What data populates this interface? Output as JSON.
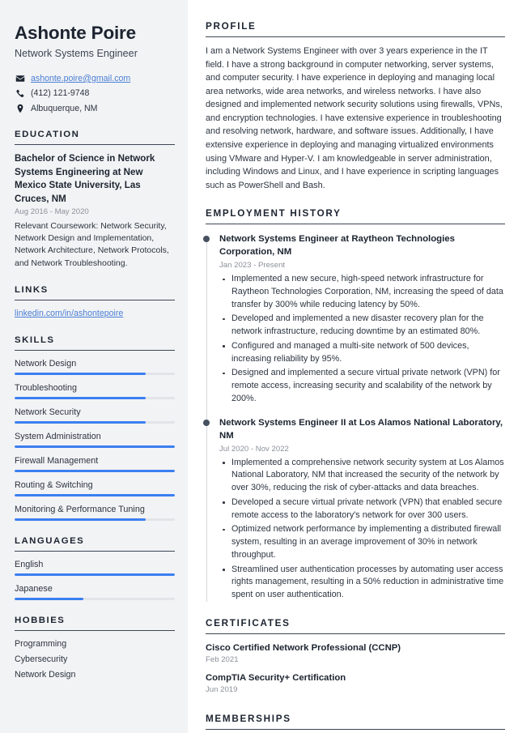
{
  "header": {
    "name": "Ashonte Poire",
    "role": "Network Systems Engineer",
    "contact": [
      {
        "icon": "envelope-icon",
        "text": "ashonte.poire@gmail.com",
        "is_link": true
      },
      {
        "icon": "phone-icon",
        "text": "(412) 121-9748",
        "is_link": false
      },
      {
        "icon": "location-pin-icon",
        "text": "Albuquerque, NM",
        "is_link": false
      }
    ]
  },
  "sidebar": {
    "education": {
      "heading": "EDUCATION",
      "degree": "Bachelor of Science in Network Systems Engineering at New Mexico State University, Las Cruces, NM",
      "date": "Aug 2016 - May 2020",
      "description": "Relevant Coursework: Network Security, Network Design and Implementation, Network Architecture, Network Protocols, and Network Troubleshooting."
    },
    "links": {
      "heading": "LINKS",
      "items": [
        {
          "label": "linkedin.com/in/ashontepoire"
        }
      ]
    },
    "skills": {
      "heading": "SKILLS",
      "items": [
        {
          "label": "Network Design",
          "level": 82
        },
        {
          "label": "Troubleshooting",
          "level": 82
        },
        {
          "label": "Network Security",
          "level": 82
        },
        {
          "label": "System Administration",
          "level": 100
        },
        {
          "label": "Firewall Management",
          "level": 100
        },
        {
          "label": "Routing & Switching",
          "level": 100
        },
        {
          "label": "Monitoring & Performance Tuning",
          "level": 82
        }
      ]
    },
    "languages": {
      "heading": "LANGUAGES",
      "items": [
        {
          "label": "English",
          "level": 100
        },
        {
          "label": "Japanese",
          "level": 43
        }
      ]
    },
    "hobbies": {
      "heading": "HOBBIES",
      "items": [
        {
          "label": "Programming"
        },
        {
          "label": "Cybersecurity"
        },
        {
          "label": "Network Design"
        }
      ]
    }
  },
  "main": {
    "profile": {
      "heading": "PROFILE",
      "text": "I am a Network Systems Engineer with over 3 years experience in the IT field. I have a strong background in computer networking, server systems, and computer security. I have experience in deploying and managing local area networks, wide area networks, and wireless networks. I have also designed and implemented network security solutions using firewalls, VPNs, and encryption technologies. I have extensive experience in troubleshooting and resolving network, hardware, and software issues. Additionally, I have extensive experience in deploying and managing virtualized environments using VMware and Hyper-V. I am knowledgeable in server administration, including Windows and Linux, and I have experience in scripting languages such as PowerShell and Bash."
    },
    "employment": {
      "heading": "EMPLOYMENT HISTORY",
      "jobs": [
        {
          "title": "Network Systems Engineer at Raytheon Technologies Corporation, NM",
          "date": "Jan 2023 - Present",
          "bullets": [
            "Implemented a new secure, high-speed network infrastructure for Raytheon Technologies Corporation, NM, increasing the speed of data transfer by 300% while reducing latency by 50%.",
            "Developed and implemented a new disaster recovery plan for the network infrastructure, reducing downtime by an estimated 80%.",
            "Configured and managed a multi-site network of 500 devices, increasing reliability by 95%.",
            "Designed and implemented a secure virtual private network (VPN) for remote access, increasing security and scalability of the network by 200%."
          ]
        },
        {
          "title": "Network Systems Engineer II at Los Alamos National Laboratory, NM",
          "date": "Jul 2020 - Nov 2022",
          "bullets": [
            "Implemented a comprehensive network security system at Los Alamos National Laboratory, NM that increased the security of the network by over 30%, reducing the risk of cyber-attacks and data breaches.",
            "Developed a secure virtual private network (VPN) that enabled secure remote access to the laboratory's network for over 300 users.",
            "Optimized network performance by implementing a distributed firewall system, resulting in an average improvement of 30% in network throughput.",
            "Streamlined user authentication processes by automating user access rights management, resulting in a 50% reduction in administrative time spent on user authentication."
          ]
        }
      ]
    },
    "certificates": {
      "heading": "CERTIFICATES",
      "items": [
        {
          "name": "Cisco Certified Network Professional (CCNP)",
          "date": "Feb 2021"
        },
        {
          "name": "CompTIA Security+ Certification",
          "date": "Jun 2019"
        }
      ]
    },
    "memberships": {
      "heading": "MEMBERSHIPS"
    }
  },
  "colors": {
    "accent_blue": "#3b7ff0",
    "link_blue": "#4a7fd4",
    "heading_dark": "#1c2430",
    "sidebar_bg": "#f2f3f5",
    "muted_gray": "#8b9099"
  }
}
